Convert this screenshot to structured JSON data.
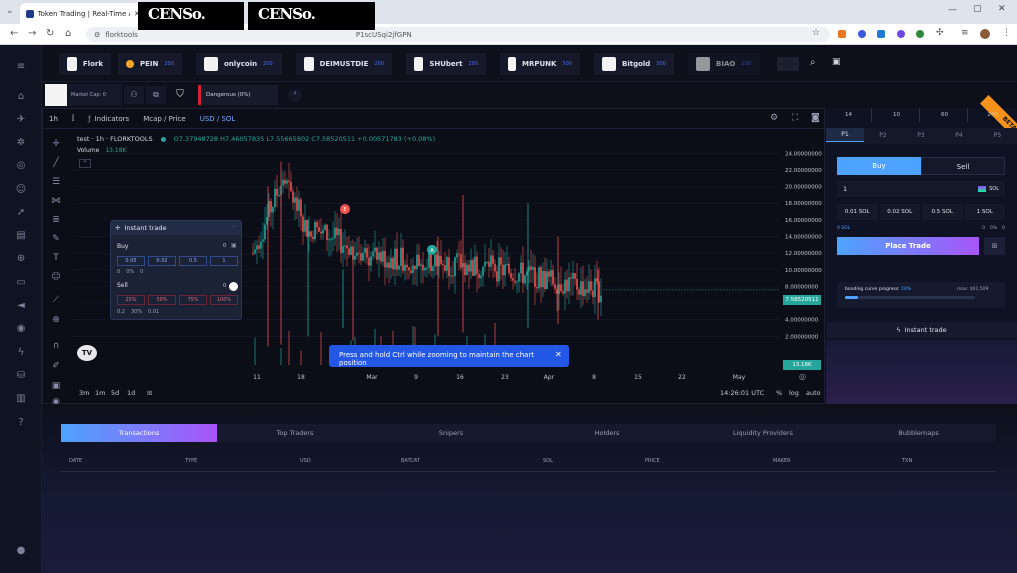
{
  "browser": {
    "tab_title": "Token Trading | Real-Time Anal",
    "url_left": "florktools",
    "url_right": "P1scUSqi2jfGPN",
    "censor_label": "CENSo."
  },
  "tickers": [
    {
      "name": "Flork",
      "badge": ""
    },
    {
      "name": "PEIN",
      "badge": "200"
    },
    {
      "name": "onlycoin",
      "badge": "200"
    },
    {
      "name": "DEIMUSTDIE",
      "badge": "200"
    },
    {
      "name": "SHUbert",
      "badge": "200"
    },
    {
      "name": "MRPUNK",
      "badge": "500"
    },
    {
      "name": "Bitgold",
      "badge": "500"
    },
    {
      "name": "BIAO",
      "badge": "200"
    }
  ],
  "infobar": {
    "market_cap": "Market Cap: 0",
    "danger": "Dangerous (0%)"
  },
  "chart_toolbar": {
    "interval": "1h",
    "indicators": "Indicators",
    "mcap_price": "Mcap / Price",
    "currency": "USD / SOL"
  },
  "chart_header": {
    "symbol": "test · 1h · FLORKTOOLS",
    "ohlc": "O7.37948728 H7.46057835 L7.55665802 C7.58520511 +0.00571783 (+0.08%)",
    "volume_label": "Volume",
    "volume_value": "13.18K"
  },
  "chart_data": {
    "type": "candlestick",
    "price_ticks": [
      "24.00000000",
      "22.00000000",
      "20.00000000",
      "18.00000000",
      "16.00000000",
      "14.00000000",
      "12.00000000",
      "10.00000000",
      "8.00000000",
      "6.00000000",
      "4.00000000",
      "2.00000000"
    ],
    "last_price": "7.58520511",
    "last_volume": "13.18K",
    "x_ticks": [
      "11",
      "18",
      "Mar",
      "9",
      "16",
      "23",
      "Apr",
      "8",
      "15",
      "22",
      "May"
    ],
    "markers": [
      "E",
      "A"
    ],
    "ylim": [
      0,
      25
    ]
  },
  "chart_footer": {
    "ranges": [
      "3m",
      "1m",
      "5d",
      "1d"
    ],
    "time": "14:26:01 UTC",
    "pct": "%",
    "log": "log",
    "auto": "auto"
  },
  "toast": "Press and hold Ctrl while zooming to maintain the chart position",
  "instant_trade_widget": {
    "title": "Instant trade",
    "buy_label": "Buy",
    "buy_amounts": [
      "0.05",
      "0.02",
      "0.5",
      "1"
    ],
    "buy_footer": [
      "0",
      "0%",
      "0"
    ],
    "sell_label": "Sell",
    "sell_amounts": [
      "25%",
      "50%",
      "75%",
      "100%"
    ],
    "sell_footer": [
      "0.2",
      "30%",
      "0.01"
    ],
    "count": "0"
  },
  "right_panel": {
    "beta": "BETA",
    "slots": [
      "14",
      "10",
      "60",
      "24H"
    ],
    "presets": [
      "P1",
      "P2",
      "P3",
      "P4",
      "P5"
    ],
    "buy": "Buy",
    "sell": "Sell",
    "amount": "1",
    "unit": "SOL",
    "quick": [
      "0.01 SOL",
      "0.02 SOL",
      "0.5 SOL",
      "1 SOL"
    ],
    "settings": [
      "0 SOL",
      "0",
      "0%",
      "0"
    ],
    "place_trade": "Place Trade",
    "bonding_label": "bonding curve progress:",
    "bonding_value": "10%",
    "bonding_max": "max: $61,509",
    "bonding_progress": 0.1,
    "instant_trade": "Instant trade"
  },
  "bottom_tabs": [
    "Transactions",
    "Top Traders",
    "Snipers",
    "Holders",
    "Liquidity Providers",
    "Bubblemaps"
  ],
  "table_headers": [
    "DATE",
    "TYPE",
    "USD",
    "BATCAT",
    "SOL",
    "PRICE",
    "MAKER",
    "TXN"
  ],
  "colors": {
    "accent": "#4da3ff",
    "buy": "#26a69a",
    "sell": "#ef5350",
    "place": "#a855f7"
  }
}
